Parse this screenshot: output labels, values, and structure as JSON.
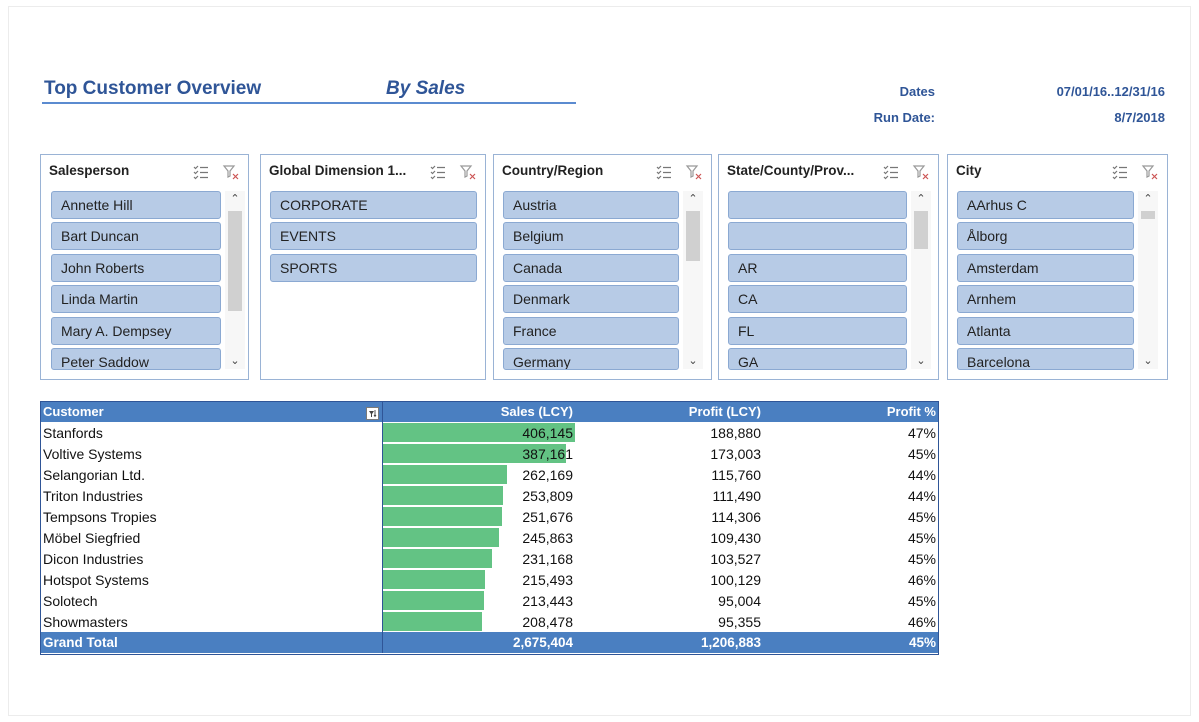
{
  "header": {
    "title": "Top Customer Overview",
    "subtitle": "By Sales",
    "dates_label": "Dates",
    "dates_value": "07/01/16..12/31/16",
    "run_date_label": "Run Date:",
    "run_date_value": "8/7/2018"
  },
  "slicers": {
    "salesperson": {
      "title": "Salesperson",
      "items": [
        "Annette Hill",
        "Bart Duncan",
        "John Roberts",
        "Linda Martin",
        "Mary A. Dempsey",
        "Peter Saddow"
      ]
    },
    "global_dimension": {
      "title": "Global Dimension 1...",
      "items": [
        "CORPORATE",
        "EVENTS",
        "SPORTS"
      ]
    },
    "country": {
      "title": "Country/Region",
      "items": [
        "Austria",
        "Belgium",
        "Canada",
        "Denmark",
        "France",
        "Germany"
      ]
    },
    "state": {
      "title": "State/County/Prov...",
      "items": [
        "",
        "",
        "AR",
        "CA",
        "FL",
        "GA"
      ]
    },
    "city": {
      "title": "City",
      "items": [
        "AArhus C",
        "Ålborg",
        "Amsterdam",
        "Arnhem",
        "Atlanta",
        "Barcelona"
      ]
    }
  },
  "table": {
    "headers": {
      "customer": "Customer",
      "sales": "Sales (LCY)",
      "profit": "Profit (LCY)",
      "pct": "Profit %"
    },
    "rows": [
      {
        "customer": "Stanfords",
        "sales": "406,145",
        "profit": "188,880",
        "pct": "47%",
        "sales_num": 406145
      },
      {
        "customer": "Voltive Systems",
        "sales": "387,161",
        "profit": "173,003",
        "pct": "45%",
        "sales_num": 387161
      },
      {
        "customer": "Selangorian Ltd.",
        "sales": "262,169",
        "profit": "115,760",
        "pct": "44%",
        "sales_num": 262169
      },
      {
        "customer": "Triton Industries",
        "sales": "253,809",
        "profit": "111,490",
        "pct": "44%",
        "sales_num": 253809
      },
      {
        "customer": "Tempsons Tropies",
        "sales": "251,676",
        "profit": "114,306",
        "pct": "45%",
        "sales_num": 251676
      },
      {
        "customer": "Möbel Siegfried",
        "sales": "245,863",
        "profit": "109,430",
        "pct": "45%",
        "sales_num": 245863
      },
      {
        "customer": "Dicon Industries",
        "sales": "231,168",
        "profit": "103,527",
        "pct": "45%",
        "sales_num": 231168
      },
      {
        "customer": "Hotspot Systems",
        "sales": "215,493",
        "profit": "100,129",
        "pct": "46%",
        "sales_num": 215493
      },
      {
        "customer": "Solotech",
        "sales": "213,443",
        "profit": "95,004",
        "pct": "45%",
        "sales_num": 213443
      },
      {
        "customer": "Showmasters",
        "sales": "208,478",
        "profit": "95,355",
        "pct": "46%",
        "sales_num": 208478
      }
    ],
    "total": {
      "label": "Grand Total",
      "sales": "2,675,404",
      "profit": "1,206,883",
      "pct": "45%"
    }
  },
  "colors": {
    "accent": "#2f5597",
    "header_fill": "#4a7fc1",
    "data_bar": "#63c384",
    "slicer_item": "#b7cbe6"
  }
}
